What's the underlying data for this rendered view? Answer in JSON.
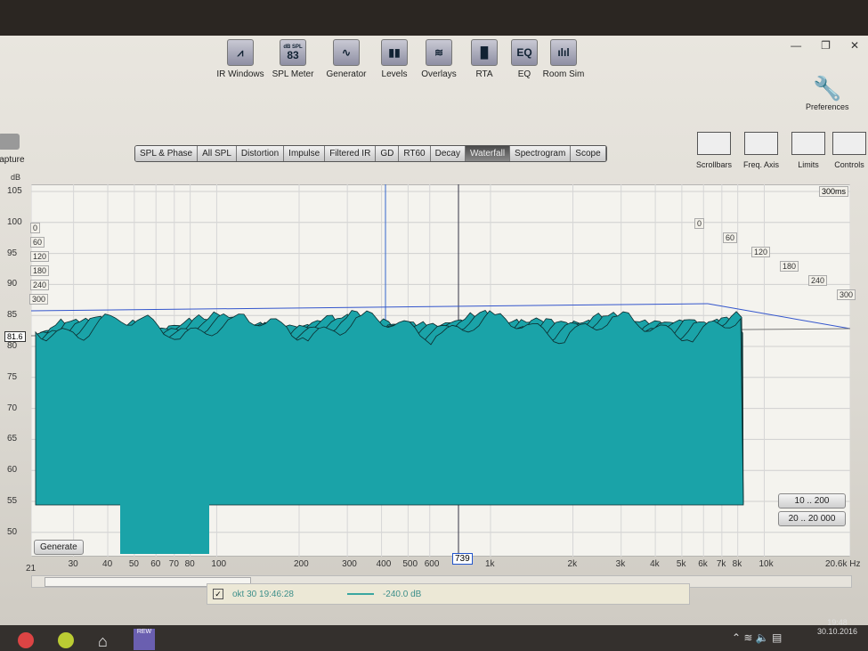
{
  "window": {
    "controls": [
      "—",
      "❐",
      "✕"
    ]
  },
  "toolbar": [
    {
      "label": "IR Windows",
      "icon": "ir-windows-icon",
      "glyph": "⩘"
    },
    {
      "label": "SPL Meter",
      "icon": "spl-meter-icon",
      "glyph": "83",
      "sub": "dB SPL"
    },
    {
      "label": "Generator",
      "icon": "generator-icon",
      "glyph": "∿"
    },
    {
      "label": "Levels",
      "icon": "levels-icon",
      "glyph": "▮▮"
    },
    {
      "label": "Overlays",
      "icon": "overlays-icon",
      "glyph": "≋"
    },
    {
      "label": "RTA",
      "icon": "rta-icon",
      "glyph": "▐▌"
    },
    {
      "label": "EQ",
      "icon": "eq-icon",
      "glyph": "EQ"
    },
    {
      "label": "Room Sim",
      "icon": "room-sim-icon",
      "glyph": "ılıl"
    }
  ],
  "preferences": "Preferences",
  "capture": "Capture",
  "tabs": [
    "SPL & Phase",
    "All SPL",
    "Distortion",
    "Impulse",
    "Filtered IR",
    "GD",
    "RT60",
    "Decay",
    "Waterfall",
    "Spectrogram",
    "Scope"
  ],
  "active_tab": "Waterfall",
  "right_tools": [
    "Scrollbars",
    "Freq. Axis",
    "Limits",
    "Controls"
  ],
  "graph": {
    "y_unit": "dB",
    "y_ticks": [
      "105",
      "100",
      "95",
      "90",
      "85",
      "80",
      "75",
      "70",
      "65",
      "60",
      "55",
      "50"
    ],
    "cursor_level": "81.6",
    "x_ticks": [
      "21",
      "30",
      "40",
      "50",
      "60",
      "70",
      "80",
      "100",
      "200",
      "300",
      "400",
      "500",
      "600",
      "1k",
      "2k",
      "3k",
      "4k",
      "5k",
      "6k",
      "7k",
      "8k",
      "10k",
      "20.6k Hz"
    ],
    "cursor_freq": "739",
    "time_range": "300ms",
    "time_ticks": [
      "0",
      "60",
      "120",
      "180",
      "240",
      "300"
    ],
    "left_time_ticks": [
      "0",
      "60",
      "120",
      "180",
      "240",
      "300"
    ],
    "generate": "Generate",
    "range_buttons": [
      "10 .. 200",
      "20 .. 20 000"
    ],
    "fill_color": "#1aa3a8"
  },
  "legend": {
    "name": "okt 30 19:46:28",
    "value": "-240.0 dB",
    "checked": true,
    "color": "#3aa6a0"
  },
  "taskbar": {
    "apps": [
      "chrome",
      "spotify",
      "home",
      "REW"
    ],
    "time": "19:48",
    "date": "30.10.2016"
  }
}
